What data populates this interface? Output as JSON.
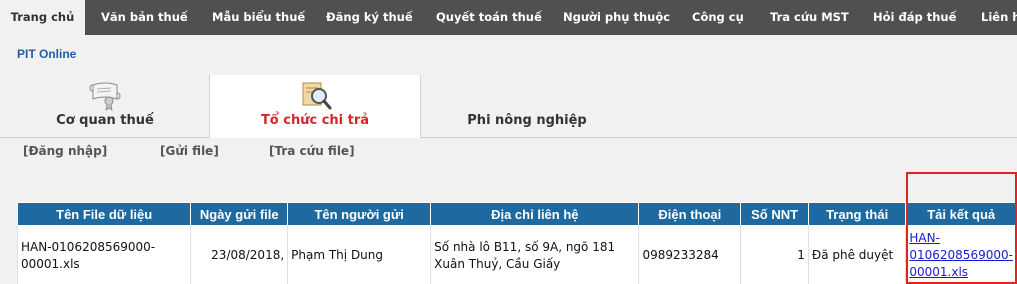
{
  "nav": {
    "items": [
      {
        "label": "Trang chủ",
        "active": true
      },
      {
        "label": "Văn bản thuế"
      },
      {
        "label": "Mẫu biểu thuế"
      },
      {
        "label": "Đăng ký thuế"
      },
      {
        "label": "Quyết toán thuế"
      },
      {
        "label": "Người phụ thuộc"
      },
      {
        "label": "Công cụ"
      },
      {
        "label": "Tra cứu MST"
      },
      {
        "label": "Hỏi đáp thuế"
      },
      {
        "label": "Liên h"
      }
    ]
  },
  "pit_link": "PIT Online",
  "tabs": [
    {
      "label": "Cơ quan thuế",
      "icon": "certificate-scroll-icon"
    },
    {
      "label": "Tổ chức chi trả",
      "icon": "magnifier-document-icon",
      "active": true
    },
    {
      "label": "Phi nông nghiệp"
    }
  ],
  "sublinks": [
    "[Đăng nhập]",
    "[Gửi file]",
    "[Tra cứu file]"
  ],
  "table": {
    "headers": [
      "Tên File dữ liệu",
      "Ngày gửi file",
      "Tên người gửi",
      "Địa chỉ liên hệ",
      "Điện thoại",
      "Số NNT",
      "Trạng thái",
      "Tải kết quả"
    ],
    "rows": [
      {
        "file_name": "HAN-0106208569000-00001.xls",
        "date": "23/08/2018,",
        "sender": "Phạm Thị Dung",
        "address": "Số nhà lô B11, số 9A, ngõ 181 Xuân Thuỷ, Cầu Giấy",
        "phone": "0989233284",
        "count": "1",
        "status": "Đã phê duyệt",
        "download": "HAN-0106208569000-00001.xls"
      }
    ]
  },
  "colors": {
    "nav_bg": "#505050",
    "header_bg": "#1e6aa0",
    "active_tab_text": "#d4262b",
    "highlight_border": "#e3231f"
  }
}
